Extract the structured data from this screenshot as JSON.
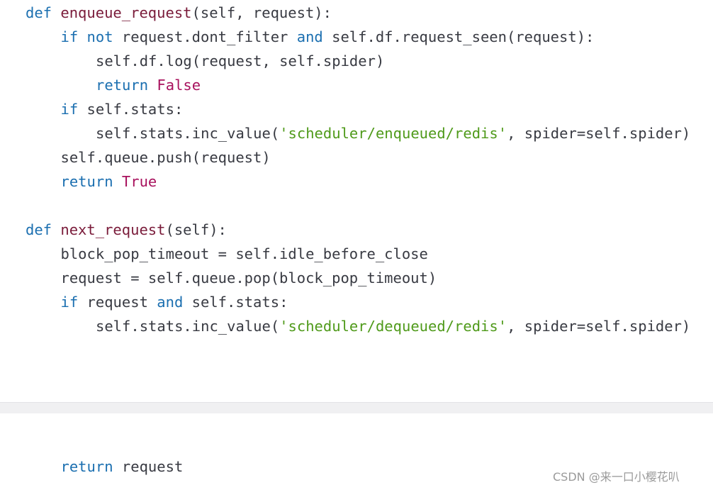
{
  "code_top": [
    {
      "indent": 0,
      "tokens": [
        {
          "t": "def",
          "c": "kw"
        },
        {
          "t": " ",
          "c": "plain"
        },
        {
          "t": "enqueue_request",
          "c": "fn"
        },
        {
          "t": "(self, request):",
          "c": "plain"
        }
      ]
    },
    {
      "indent": 1,
      "tokens": [
        {
          "t": "if",
          "c": "kw"
        },
        {
          "t": " ",
          "c": "plain"
        },
        {
          "t": "not",
          "c": "kw"
        },
        {
          "t": " request.dont_filter ",
          "c": "plain"
        },
        {
          "t": "and",
          "c": "kw"
        },
        {
          "t": " self.df.request_seen(request):",
          "c": "plain"
        }
      ]
    },
    {
      "indent": 2,
      "tokens": [
        {
          "t": "self.df.log(request, self.spider)",
          "c": "plain"
        }
      ]
    },
    {
      "indent": 2,
      "tokens": [
        {
          "t": "return",
          "c": "kw"
        },
        {
          "t": " ",
          "c": "plain"
        },
        {
          "t": "False",
          "c": "bool"
        }
      ]
    },
    {
      "indent": 1,
      "tokens": [
        {
          "t": "if",
          "c": "kw"
        },
        {
          "t": " self.stats:",
          "c": "plain"
        }
      ]
    },
    {
      "indent": 2,
      "tokens": [
        {
          "t": "self.stats.inc_value(",
          "c": "plain"
        },
        {
          "t": "'scheduler/enqueued/redis'",
          "c": "str"
        },
        {
          "t": ", spider=self.spider)",
          "c": "plain"
        }
      ]
    },
    {
      "indent": 1,
      "tokens": [
        {
          "t": "self.queue.push(request)",
          "c": "plain"
        }
      ]
    },
    {
      "indent": 1,
      "tokens": [
        {
          "t": "return",
          "c": "kw"
        },
        {
          "t": " ",
          "c": "plain"
        },
        {
          "t": "True",
          "c": "bool"
        }
      ]
    },
    {
      "indent": 0,
      "tokens": []
    },
    {
      "indent": 0,
      "tokens": [
        {
          "t": "def",
          "c": "kw"
        },
        {
          "t": " ",
          "c": "plain"
        },
        {
          "t": "next_request",
          "c": "fn"
        },
        {
          "t": "(self):",
          "c": "plain"
        }
      ]
    },
    {
      "indent": 1,
      "tokens": [
        {
          "t": "block_pop_timeout = self.idle_before_close",
          "c": "plain"
        }
      ]
    },
    {
      "indent": 1,
      "tokens": [
        {
          "t": "request = self.queue.pop(block_pop_timeout)",
          "c": "plain"
        }
      ]
    },
    {
      "indent": 1,
      "tokens": [
        {
          "t": "if",
          "c": "kw"
        },
        {
          "t": " request ",
          "c": "plain"
        },
        {
          "t": "and",
          "c": "kw"
        },
        {
          "t": " self.stats:",
          "c": "plain"
        }
      ]
    },
    {
      "indent": 2,
      "tokens": [
        {
          "t": "self.stats.inc_value(",
          "c": "plain"
        },
        {
          "t": "'scheduler/dequeued/redis'",
          "c": "str"
        },
        {
          "t": ", spider=self.spider)",
          "c": "plain"
        }
      ]
    }
  ],
  "code_bottom": [
    {
      "indent": 1,
      "tokens": [
        {
          "t": "return",
          "c": "kw"
        },
        {
          "t": " request",
          "c": "plain"
        }
      ]
    }
  ],
  "colors": {
    "keyword": "#1b6fb0",
    "function_name": "#7a1b3a",
    "boolean": "#a8115d",
    "string": "#4f9a1a",
    "text": "#383a42"
  },
  "watermark": "CSDN @来一口小樱花叭"
}
